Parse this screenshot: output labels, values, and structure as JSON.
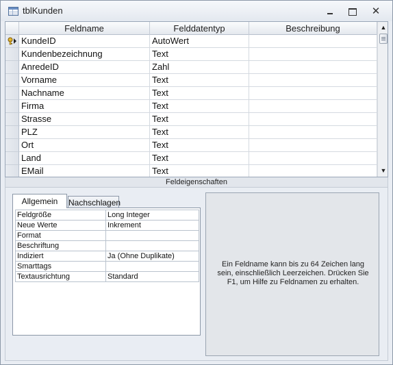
{
  "window": {
    "title": "tblKunden",
    "icon": "table-icon",
    "controls": [
      "minimize",
      "maximize",
      "close"
    ]
  },
  "grid": {
    "columns": [
      "Feldname",
      "Felddatentyp",
      "Beschreibung"
    ],
    "rows": [
      {
        "name": "KundeID",
        "type": "AutoWert",
        "description": "",
        "primary_key": true
      },
      {
        "name": "Kundenbezeichnung",
        "type": "Text",
        "description": ""
      },
      {
        "name": "AnredeID",
        "type": "Zahl",
        "description": ""
      },
      {
        "name": "Vorname",
        "type": "Text",
        "description": ""
      },
      {
        "name": "Nachname",
        "type": "Text",
        "description": ""
      },
      {
        "name": "Firma",
        "type": "Text",
        "description": ""
      },
      {
        "name": "Strasse",
        "type": "Text",
        "description": ""
      },
      {
        "name": "PLZ",
        "type": "Text",
        "description": ""
      },
      {
        "name": "Ort",
        "type": "Text",
        "description": ""
      },
      {
        "name": "Land",
        "type": "Text",
        "description": ""
      },
      {
        "name": "EMail",
        "type": "Text",
        "description": ""
      }
    ]
  },
  "properties": {
    "section_label": "Feldeigenschaften",
    "tabs": [
      "Allgemein",
      "Nachschlagen"
    ],
    "active_tab": "Allgemein",
    "items": [
      {
        "label": "Feldgröße",
        "value": "Long Integer"
      },
      {
        "label": "Neue Werte",
        "value": "Inkrement"
      },
      {
        "label": "Format",
        "value": ""
      },
      {
        "label": "Beschriftung",
        "value": ""
      },
      {
        "label": "Indiziert",
        "value": "Ja (Ohne Duplikate)"
      },
      {
        "label": "Smarttags",
        "value": ""
      },
      {
        "label": "Textausrichtung",
        "value": "Standard"
      }
    ],
    "help_text": "Ein Feldname kann bis zu 64 Zeichen lang sein, einschließlich Leerzeichen. Drücken Sie F1, um Hilfe zu Feldnamen zu erhalten."
  }
}
